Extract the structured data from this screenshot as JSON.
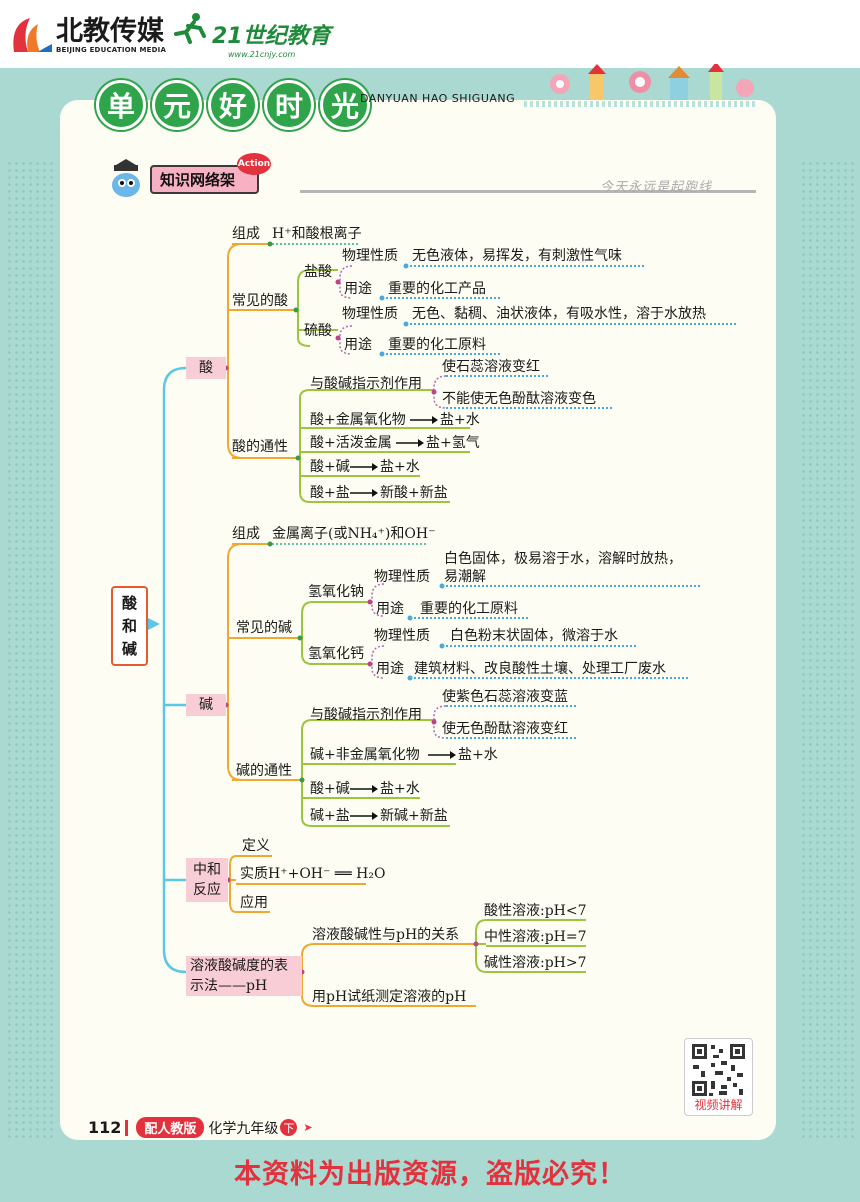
{
  "header": {
    "brand1": "北教传媒",
    "brand1_en": "BEIJING EDUCATION MEDIA",
    "brand2": "21世纪教育",
    "brand2_url": "www.21cnjy.com"
  },
  "unit": {
    "title_chars": [
      "单",
      "元",
      "好",
      "时",
      "光"
    ],
    "pinyin": "DANYUAN HAO SHIGUANG"
  },
  "section": {
    "label": "知识网络架",
    "badge": "Action",
    "slogan": "今天永远是起跑线"
  },
  "map": {
    "root": [
      "酸",
      "和",
      "碱"
    ],
    "acid": {
      "label": "酸",
      "composition": "组成",
      "composition_val": "H⁺和酸根离子",
      "common": "常见的酸",
      "hcl": "盐酸",
      "hcl_phys_label": "物理性质",
      "hcl_phys": "无色液体，易挥发，有刺激性气味",
      "hcl_use_label": "用途",
      "hcl_use": "重要的化工产品",
      "h2so4": "硫酸",
      "h2so4_phys_label": "物理性质",
      "h2so4_phys": "无色、黏稠、油状液体，有吸水性，溶于水放热",
      "h2so4_use_label": "用途",
      "h2so4_use": "重要的化工原料",
      "general": "酸的通性",
      "indicator": "与酸碱指示剂作用",
      "ind1": "使石蕊溶液变红",
      "ind2": "不能使无色酚酞溶液变色",
      "r1": "酸+金属氧化物",
      "r1p": "盐+水",
      "r2": "酸+活泼金属",
      "r2p": "盐+氢气",
      "r3": "酸+碱",
      "r3p": "盐+水",
      "r4": "酸+盐",
      "r4p": "新酸+新盐"
    },
    "base": {
      "label": "碱",
      "composition": "组成",
      "composition_val": "金属离子(或NH₄⁺)和OH⁻",
      "common": "常见的碱",
      "naoh": "氢氧化钠",
      "naoh_phys_label": "物理性质",
      "naoh_phys1": "白色固体，极易溶于水，溶解时放热，",
      "naoh_phys2": "易潮解",
      "naoh_use_label": "用途",
      "naoh_use": "重要的化工原料",
      "caoh": "氢氧化钙",
      "caoh_phys_label": "物理性质",
      "caoh_phys": "白色粉末状固体，微溶于水",
      "caoh_use_label": "用途",
      "caoh_use": "建筑材料、改良酸性土壤、处理工厂废水",
      "general": "碱的通性",
      "indicator": "与酸碱指示剂作用",
      "ind1": "使紫色石蕊溶液变蓝",
      "ind2": "使无色酚酞溶液变红",
      "r1": "碱+非金属氧化物",
      "r1p": "盐+水",
      "r2": "酸+碱",
      "r2p": "盐+水",
      "r3": "碱+盐",
      "r3p": "新碱+新盐"
    },
    "neutral": {
      "label1": "中和",
      "label2": "反应",
      "def": "定义",
      "essence": "实质H⁺+OH⁻ ══ H₂O",
      "app": "应用"
    },
    "ph": {
      "label1": "溶液酸碱度的表",
      "label2": "示法——pH",
      "rel": "溶液酸碱性与pH的关系",
      "acid": "酸性溶液:pH<7",
      "neutral": "中性溶液:pH=7",
      "basic": "碱性溶液:pH>7",
      "measure": "用pH试纸测定溶液的pH"
    }
  },
  "qr_caption": "视频讲解",
  "footer": {
    "page": "112",
    "edition": "配人教版",
    "subject": "化学九年级",
    "volume": "下"
  },
  "warning": "本资料为出版资源，盗版必究！",
  "colors": {
    "background": "#a9d9d1",
    "accent_green": "#2fa44a",
    "pink_box": "#f8cdd6",
    "line_blue": "#5bc7e8",
    "line_orange": "#f0a830",
    "line_green": "#9bc53d",
    "warning_red": "#e2323e"
  }
}
